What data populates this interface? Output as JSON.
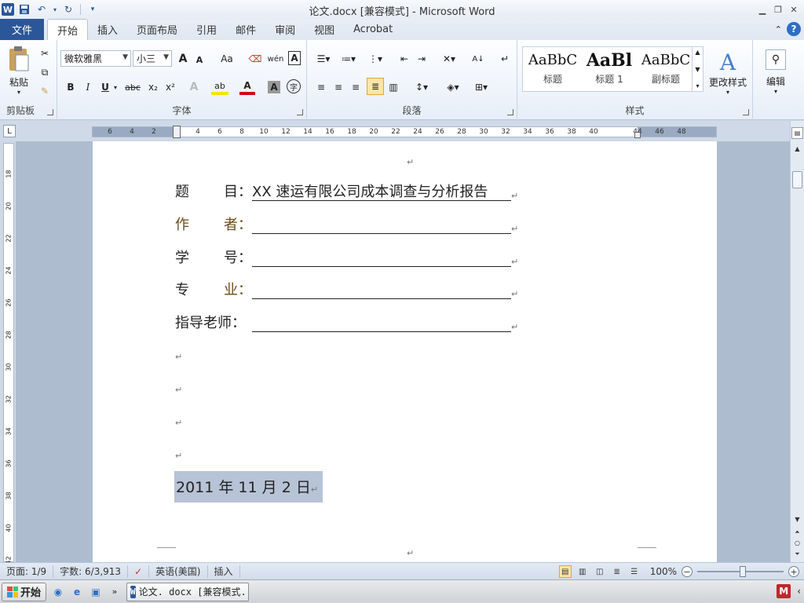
{
  "window": {
    "title": "论文.docx [兼容模式] - Microsoft Word",
    "app_icon": "W"
  },
  "tabs": [
    "开始",
    "插入",
    "页面布局",
    "引用",
    "邮件",
    "审阅",
    "视图",
    "Acrobat"
  ],
  "file_tab": "文件",
  "ribbon": {
    "clipboard": {
      "paste_label": "粘贴",
      "group_label": "剪贴板"
    },
    "font": {
      "font_name": "微软雅黑",
      "font_size": "小三",
      "grow": "A",
      "shrink": "A",
      "case": "Aa",
      "bold": "B",
      "italic": "I",
      "underline": "U",
      "strike": "abc",
      "subscript": "x₂",
      "superscript": "x²",
      "group_label": "字体"
    },
    "paragraph": {
      "group_label": "段落"
    },
    "styles": {
      "items": [
        {
          "sample": "AaBbC",
          "name": "标题"
        },
        {
          "sample": "AaBl",
          "name": "标题 1"
        },
        {
          "sample": "AaBbC",
          "name": "副标题"
        }
      ],
      "change_styles": "更改样式",
      "group_label": "样式"
    },
    "editing": {
      "label": "编辑"
    }
  },
  "ruler": {
    "h_ticks": [
      "6",
      "4",
      "2",
      "2",
      "4",
      "6",
      "8",
      "10",
      "12",
      "14",
      "16",
      "18",
      "20",
      "22",
      "24",
      "26",
      "28",
      "30",
      "32",
      "34",
      "36",
      "38",
      "40",
      "44",
      "46",
      "48"
    ],
    "v_ticks": [
      "18",
      "20",
      "22",
      "24",
      "26",
      "28",
      "30",
      "32",
      "34",
      "36",
      "38",
      "40",
      "42"
    ]
  },
  "document": {
    "fields": [
      {
        "label_chars": [
          "题",
          "目："
        ],
        "value": "XX 速运有限公司成本调查与分析报告"
      },
      {
        "label_chars": [
          "作",
          "者："
        ],
        "value": ""
      },
      {
        "label_chars": [
          "学",
          "号："
        ],
        "value": ""
      },
      {
        "label_chars": [
          "专",
          "业："
        ],
        "value": ""
      },
      {
        "label_chars": [
          "指导老师："
        ],
        "value": ""
      }
    ],
    "date": "2011 年 11 月 2 日",
    "para_mark": "↵"
  },
  "statusbar": {
    "page": "页面: 1/9",
    "words": "字数: 6/3,913",
    "language": "英语(美国)",
    "mode": "插入",
    "zoom": "100%"
  },
  "taskbar": {
    "start": "开始",
    "task_item": "论文. docx [兼容模式..."
  },
  "colors": {
    "accent": "#2b579a",
    "selection": "#b7c3d6"
  }
}
